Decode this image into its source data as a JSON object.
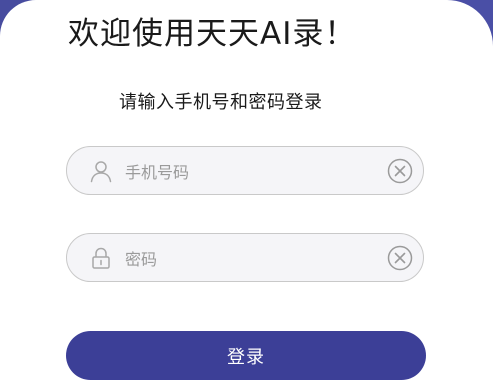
{
  "header": {
    "welcome": "欢迎使用天天AI录！",
    "subtitle": "请输入手机号和密码登录"
  },
  "form": {
    "phone": {
      "placeholder": "手机号码",
      "icon": "user-icon",
      "clear_icon": "clear-icon"
    },
    "password": {
      "placeholder": "密码",
      "icon": "lock-icon",
      "clear_icon": "clear-icon"
    },
    "submit_label": "登录"
  },
  "colors": {
    "accent": "#3c3f97",
    "background": "#4a4fa6",
    "field_bg": "#f5f5f8",
    "placeholder": "#9a9a9a"
  }
}
